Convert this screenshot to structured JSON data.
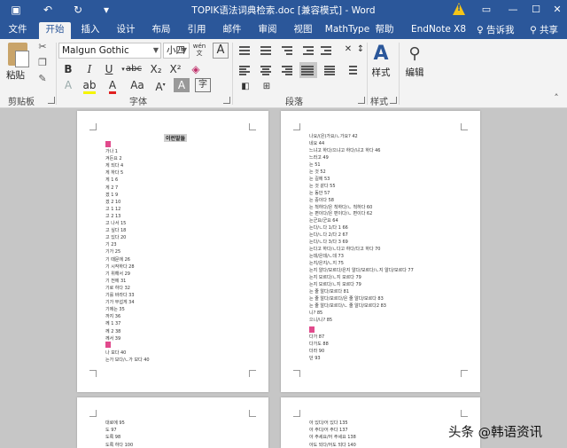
{
  "window": {
    "title": "TOPIK语法词典检索.doc [兼容模式] - Word",
    "save_icon": "save-icon"
  },
  "tabs": [
    {
      "label": "文件"
    },
    {
      "label": "开始"
    },
    {
      "label": "插入"
    },
    {
      "label": "设计"
    },
    {
      "label": "布局"
    },
    {
      "label": "引用"
    },
    {
      "label": "邮件"
    },
    {
      "label": "审阅"
    },
    {
      "label": "视图"
    },
    {
      "label": "MathType"
    },
    {
      "label": "帮助"
    },
    {
      "label": "EndNote X8"
    }
  ],
  "tell_me": "告诉我",
  "share": "共享",
  "ribbon": {
    "paste": "粘贴",
    "clipboard": "剪贴板",
    "font_name": "Malgun Gothic",
    "font_size": "小四",
    "font_group": "字体",
    "paragraph_group": "段落",
    "styles_btn": "样式",
    "styles_group": "样式",
    "edit_btn": "编辑",
    "phonetic": "wén",
    "bold": "B",
    "italic": "I",
    "underline": "U",
    "strike": "abc",
    "subscript": "X₂",
    "superscript": "X²",
    "big_a": "A",
    "case_a": "Aa"
  },
  "page1": {
    "title": "이런말들",
    "lines": [
      "가나  1",
      "겨든요  2",
      "게 되다  4",
      "게 하다  5",
      "게 1  6",
      "게 2  7",
      "겠 1  9",
      "겠 2  10",
      "고 1  12",
      "고 2  13",
      "고 나서  15",
      "고 싶다  18",
      "고 있다  20",
      "기  23",
      "기가  25",
      "기 때문에  26",
      "기 시작하다  28",
      "기 위해서  29",
      "기 전에  31",
      "기로 하다  32",
      "기를 바라다  33",
      "기가 무섭게  34",
      "기에는  35",
      "까지  36",
      "께 1  37",
      "께 2  38",
      "께서  39"
    ],
    "lines_b": [
      "나 보다  40",
      "는가 보다/ㄴ가 보다  40"
    ]
  },
  "page2": {
    "lines": [
      "나요/(은)가요/ㄴ가요?  42",
      "네요  44",
      "느냐고 하다/으냐고 하다/냐고 하다  46",
      "느라고  49",
      "는  51",
      "는 것  52",
      "는 길에  53",
      "는 것 같다  55",
      "는 동안  57",
      "는 중이다  58",
      "는 척하다/은 척하다/ㄴ 척하다  60",
      "는 편이다/은 편이다/ㄴ 편이다  62",
      "는군요/군요  64",
      "는다/ㄴ다 1/다 1  66",
      "는다/ㄴ다 2/다 2  67",
      "는다/ㄴ다 3/다 3  69",
      "는다고 하다/ㄴ다고 하다/다고 하다  70",
      "는데/은데/ㄴ데  73",
      "는지/은지/ㄴ지  75",
      "는지 알다/모르다/은지 알다/모르다/ㄴ지 알다/모르다  77",
      "는지 모르다/ㄴ지 모르다  79",
      "는지 모르다/ㄴ지 모르다  79",
      "는 줄 알다/모르다  81",
      "는 줄 알다/모르다/은 줄 알다/모르다  83",
      "는 줄 알다/모르다/ㄴ 줄 알다/모르다2  83",
      "니?  85",
      "으니/니?  85"
    ],
    "lines_b": [
      "다가  87",
      "다가도  88",
      "더라  90",
      "던  93"
    ]
  },
  "page3": {
    "lines": [
      "대로에  95",
      "도  97",
      "도록  98",
      "도록 하다  100"
    ]
  },
  "page4": {
    "lines": [
      "아 있다/어 있다  135",
      "아 주다/어 주다  137",
      "아 주세요/어 주세요  138",
      "아도 되다/어도 되다  140"
    ]
  },
  "watermark": "头条 @韩语资讯"
}
